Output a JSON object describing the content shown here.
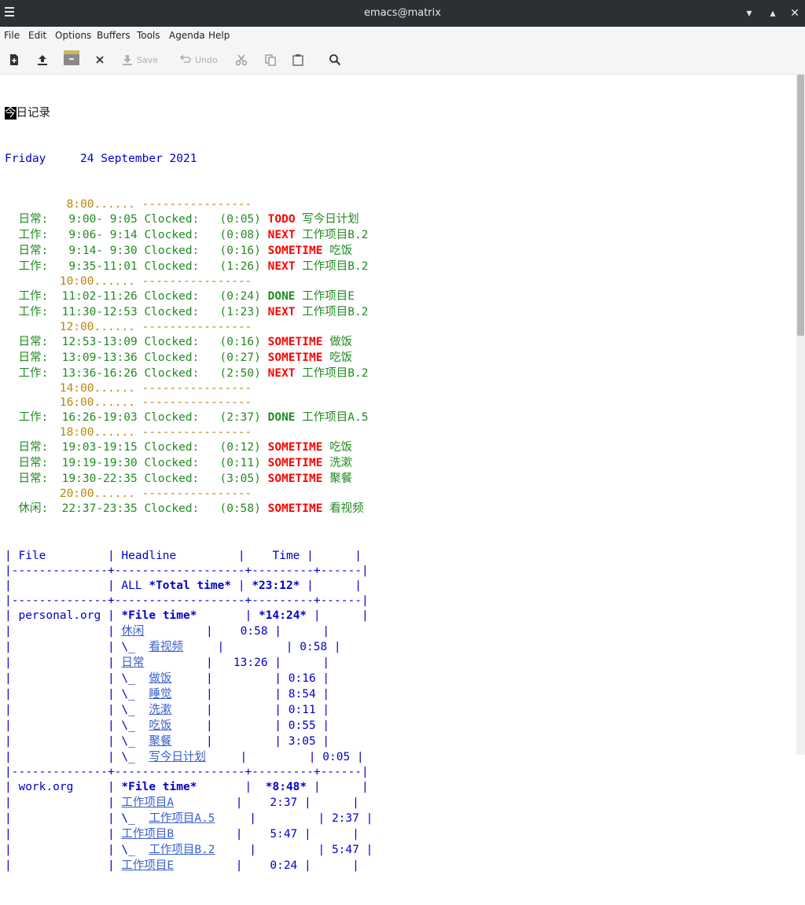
{
  "window": {
    "title": "emacs@matrix",
    "minimize": "▾",
    "maximize": "▴",
    "close": "✕"
  },
  "menus": [
    "File",
    "Edit",
    "Options",
    "Buffers",
    "Tools",
    "Agenda",
    "Help"
  ],
  "toolbar": {
    "save": "Save",
    "undo": "Undo"
  },
  "buffer": {
    "cursor_char": "今",
    "title_rest": "日记录",
    "weekday": "Friday",
    "date": "24 September 2021",
    "agenda": [
      {
        "kind": "grid",
        "time": "8:00......",
        "dashes": "----------------"
      },
      {
        "kind": "entry",
        "cat": "日常:",
        "time": "9:00- 9:05",
        "clocked": "Clocked:",
        "dur": "(0:05)",
        "state": "TODO",
        "task": "写今日计划"
      },
      {
        "kind": "entry",
        "cat": "工作:",
        "time": "9:06- 9:14",
        "clocked": "Clocked:",
        "dur": "(0:08)",
        "state": "NEXT",
        "task": "工作项目B.2"
      },
      {
        "kind": "entry",
        "cat": "日常:",
        "time": "9:14- 9:30",
        "clocked": "Clocked:",
        "dur": "(0:16)",
        "state": "SOMETIME",
        "task": "吃饭"
      },
      {
        "kind": "entry",
        "cat": "工作:",
        "time": "9:35-11:01",
        "clocked": "Clocked:",
        "dur": "(1:26)",
        "state": "NEXT",
        "task": "工作项目B.2"
      },
      {
        "kind": "grid",
        "time": "10:00......",
        "dashes": "----------------"
      },
      {
        "kind": "entry",
        "cat": "工作:",
        "time": "11:02-11:26",
        "clocked": "Clocked:",
        "dur": "(0:24)",
        "state": "DONE",
        "task": "工作项目E"
      },
      {
        "kind": "entry",
        "cat": "工作:",
        "time": "11:30-12:53",
        "clocked": "Clocked:",
        "dur": "(1:23)",
        "state": "NEXT",
        "task": "工作项目B.2"
      },
      {
        "kind": "grid",
        "time": "12:00......",
        "dashes": "----------------"
      },
      {
        "kind": "entry",
        "cat": "日常:",
        "time": "12:53-13:09",
        "clocked": "Clocked:",
        "dur": "(0:16)",
        "state": "SOMETIME",
        "task": "做饭"
      },
      {
        "kind": "entry",
        "cat": "日常:",
        "time": "13:09-13:36",
        "clocked": "Clocked:",
        "dur": "(0:27)",
        "state": "SOMETIME",
        "task": "吃饭"
      },
      {
        "kind": "entry",
        "cat": "工作:",
        "time": "13:36-16:26",
        "clocked": "Clocked:",
        "dur": "(2:50)",
        "state": "NEXT",
        "task": "工作项目B.2"
      },
      {
        "kind": "grid",
        "time": "14:00......",
        "dashes": "----------------"
      },
      {
        "kind": "grid",
        "time": "16:00......",
        "dashes": "----------------"
      },
      {
        "kind": "entry",
        "cat": "工作:",
        "time": "16:26-19:03",
        "clocked": "Clocked:",
        "dur": "(2:37)",
        "state": "DONE",
        "task": "工作项目A.5"
      },
      {
        "kind": "grid",
        "time": "18:00......",
        "dashes": "----------------"
      },
      {
        "kind": "entry",
        "cat": "日常:",
        "time": "19:03-19:15",
        "clocked": "Clocked:",
        "dur": "(0:12)",
        "state": "SOMETIME",
        "task": "吃饭"
      },
      {
        "kind": "entry",
        "cat": "日常:",
        "time": "19:19-19:30",
        "clocked": "Clocked:",
        "dur": "(0:11)",
        "state": "SOMETIME",
        "task": "洗漱"
      },
      {
        "kind": "entry",
        "cat": "日常:",
        "time": "19:30-22:35",
        "clocked": "Clocked:",
        "dur": "(3:05)",
        "state": "SOMETIME",
        "task": "聚餐"
      },
      {
        "kind": "grid",
        "time": "20:00......",
        "dashes": "----------------"
      },
      {
        "kind": "entry",
        "cat": "休闲:",
        "time": "22:37-23:35",
        "clocked": "Clocked:",
        "dur": "(0:58)",
        "state": "SOMETIME",
        "task": "看视频"
      }
    ],
    "table": {
      "headers": [
        "File",
        "Headline",
        "Time",
        ""
      ],
      "sep": "|--------------+-------------------+---------+------|",
      "total_label": "ALL",
      "total_headline": "*Total time*",
      "total_time": "*23:12*",
      "files": [
        {
          "file": "personal.org",
          "file_time_label": "*File time*",
          "file_time": "*14:24*",
          "rows": [
            {
              "level": 1,
              "headline": "休闲",
              "time": "0:58"
            },
            {
              "level": 2,
              "prefix": "\\_",
              "headline": "看视频",
              "time": "0:58"
            },
            {
              "level": 1,
              "headline": "日常",
              "time": "13:26"
            },
            {
              "level": 2,
              "prefix": "\\_",
              "headline": "做饭",
              "time": "0:16"
            },
            {
              "level": 2,
              "prefix": "\\_",
              "headline": "睡觉",
              "time": "8:54"
            },
            {
              "level": 2,
              "prefix": "\\_",
              "headline": "洗漱",
              "time": "0:11"
            },
            {
              "level": 2,
              "prefix": "\\_",
              "headline": "吃饭",
              "time": "0:55"
            },
            {
              "level": 2,
              "prefix": "\\_",
              "headline": "聚餐",
              "time": "3:05"
            },
            {
              "level": 2,
              "prefix": "\\_",
              "headline": "写今日计划",
              "time": "0:05"
            }
          ]
        },
        {
          "file": "work.org",
          "file_time_label": "*File time*",
          "file_time": "*8:48*",
          "rows": [
            {
              "level": 1,
              "headline": "工作项目A",
              "time": "2:37"
            },
            {
              "level": 2,
              "prefix": "\\_",
              "headline": "工作项目A.5",
              "time": "2:37"
            },
            {
              "level": 1,
              "headline": "工作项目B",
              "time": "5:47"
            },
            {
              "level": 2,
              "prefix": "\\_",
              "headline": "工作项目B.2",
              "time": "5:47"
            },
            {
              "level": 1,
              "headline": "工作项目E",
              "time": "0:24"
            }
          ]
        }
      ]
    }
  }
}
